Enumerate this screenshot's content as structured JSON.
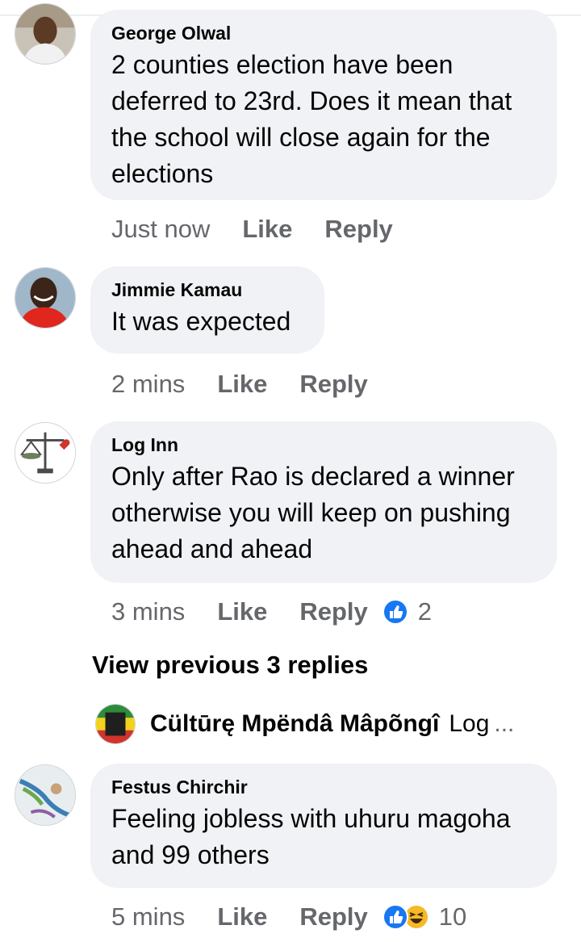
{
  "comments": [
    {
      "author": "George Olwal",
      "lines": [
        "2 counties election have been",
        "deferred to 23rd. Does it mean that",
        "the school will close again for the",
        "elections"
      ],
      "time": "Just now",
      "like": "Like",
      "reply": "Reply"
    },
    {
      "author": "Jimmie Kamau",
      "lines": [
        "It was expected"
      ],
      "time": "2 mins",
      "like": "Like",
      "reply": "Reply"
    },
    {
      "author": "Log Inn",
      "lines": [
        "Only after Rao is declared a winner",
        "otherwise you will keep on pushing",
        "ahead and ahead"
      ],
      "time": "3 mins",
      "like": "Like",
      "reply": "Reply",
      "reaction_count": "2",
      "reactions": [
        "like-reaction"
      ]
    },
    {
      "author": "Festus Chirchir",
      "lines": [
        "Feeling jobless with uhuru magoha",
        "and 99 others"
      ],
      "time": "5 mins",
      "like": "Like",
      "reply": "Reply",
      "reaction_count": "10",
      "reactions": [
        "like-reaction",
        "haha-reaction"
      ]
    }
  ],
  "view_previous": "View previous 3 replies",
  "reply_preview": {
    "author": "Cültūrę Mpëndâ Mâpõngî",
    "snippet": "Log",
    "ellipsis": "..."
  },
  "colors": {
    "bubble": "#f0f2f5",
    "meta_text": "#65676b",
    "like_blue": "#1877f2",
    "haha_yellow": "#f7b928"
  }
}
